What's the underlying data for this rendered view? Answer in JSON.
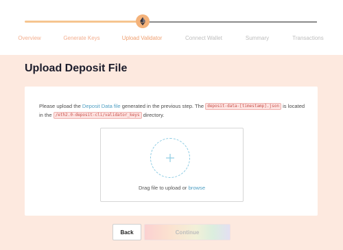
{
  "stepper": {
    "steps": [
      {
        "label": "Overview",
        "state": "done"
      },
      {
        "label": "Generate Keys",
        "state": "done"
      },
      {
        "label": "Upload Validator",
        "state": "active"
      },
      {
        "label": "Connect Wallet",
        "state": "todo"
      },
      {
        "label": "Summary",
        "state": "todo"
      },
      {
        "label": "Transactions",
        "state": "todo"
      }
    ],
    "marker_icon": "ethereum-icon"
  },
  "page": {
    "title": "Upload Deposit File"
  },
  "instructions": {
    "part1": "Please upload the ",
    "link": "Deposit Data file",
    "part2": " generated in the previous step. The ",
    "file_chip": "deposit-data-[timestamp].json",
    "part3": " is located in the ",
    "dir_chip": "/eth2.0-deposit-cli/validator_keys",
    "part4": " directory."
  },
  "dropzone": {
    "icon": "plus-icon",
    "text": "Drag file to upload or ",
    "browse": "browse"
  },
  "buttons": {
    "back": "Back",
    "continue": "Continue"
  },
  "colors": {
    "background": "#fde9df",
    "accent": "#f4b27a",
    "link": "#4d9ec2"
  }
}
